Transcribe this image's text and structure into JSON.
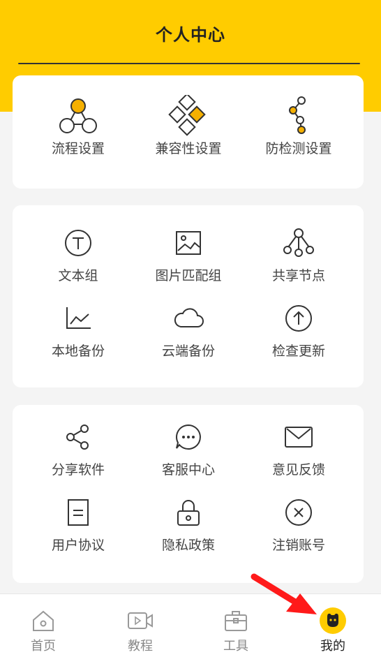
{
  "header": {
    "title": "个人中心"
  },
  "colors": {
    "accent": "#ffcc00",
    "icon_highlight": "#f5b000",
    "icon_stroke": "#333333",
    "arrow": "#ff1a1a"
  },
  "card1": {
    "items": [
      {
        "label": "流程设置",
        "icon": "flow-nodes-icon"
      },
      {
        "label": "兼容性设置",
        "icon": "diamond-grid-icon"
      },
      {
        "label": "防检测设置",
        "icon": "chain-nodes-icon"
      }
    ]
  },
  "card2": {
    "items": [
      {
        "label": "文本组",
        "icon": "text-circle-icon"
      },
      {
        "label": "图片匹配组",
        "icon": "image-icon"
      },
      {
        "label": "共享节点",
        "icon": "tree-nodes-icon"
      },
      {
        "label": "本地备份",
        "icon": "line-chart-icon"
      },
      {
        "label": "云端备份",
        "icon": "cloud-icon"
      },
      {
        "label": "检查更新",
        "icon": "arrow-up-circle-icon"
      }
    ]
  },
  "card3": {
    "items": [
      {
        "label": "分享软件",
        "icon": "share-icon"
      },
      {
        "label": "客服中心",
        "icon": "chat-bubble-icon"
      },
      {
        "label": "意见反馈",
        "icon": "mail-icon"
      },
      {
        "label": "用户协议",
        "icon": "document-icon"
      },
      {
        "label": "隐私政策",
        "icon": "lock-icon"
      },
      {
        "label": "注销账号",
        "icon": "close-circle-icon"
      }
    ]
  },
  "tabbar": {
    "tabs": [
      {
        "label": "首页",
        "icon": "home-icon",
        "active": false
      },
      {
        "label": "教程",
        "icon": "video-icon",
        "active": false
      },
      {
        "label": "工具",
        "icon": "toolbox-icon",
        "active": false
      },
      {
        "label": "我的",
        "icon": "avatar-icon",
        "active": true
      }
    ]
  }
}
